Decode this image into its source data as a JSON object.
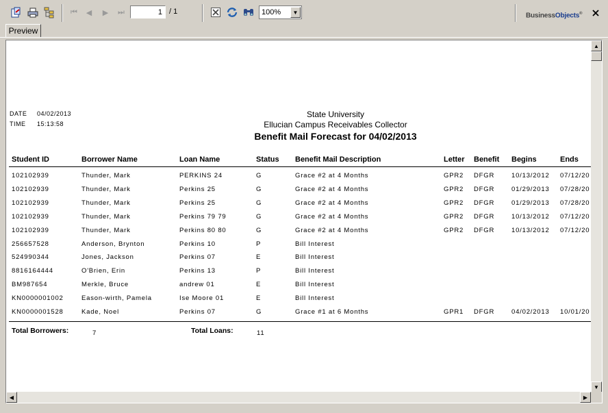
{
  "toolbar": {
    "page_current": "1",
    "page_total": "/ 1",
    "zoom": "100%",
    "logo_a": "Business",
    "logo_b": "Objects",
    "logo_tm": "®"
  },
  "tabs": [
    {
      "label": "Preview"
    }
  ],
  "report": {
    "date_label": "DATE",
    "date_value": "04/02/2013",
    "time_label": "TIME",
    "time_value": "15:13:58",
    "institution": "State University",
    "system": "Ellucian Campus Receivables Collector",
    "title": "Benefit Mail Forecast for 04/02/2013",
    "columns": [
      "Student ID",
      "Borrower Name",
      "Loan Name",
      "Status",
      "Benefit Mail Description",
      "Letter",
      "Benefit",
      "Begins",
      "Ends"
    ],
    "rows": [
      [
        "102102939",
        "Thunder, Mark",
        "PERKINS 24",
        "G",
        "Grace #2 at 4 Months",
        "GPR2",
        "DFGR",
        "10/13/2012",
        "07/12/20"
      ],
      [
        "102102939",
        "Thunder, Mark",
        "Perkins 25",
        "G",
        "Grace #2 at 4 Months",
        "GPR2",
        "DFGR",
        "01/29/2013",
        "07/28/20"
      ],
      [
        "102102939",
        "Thunder, Mark",
        "Perkins 25",
        "G",
        "Grace #2 at 4 Months",
        "GPR2",
        "DFGR",
        "01/29/2013",
        "07/28/20"
      ],
      [
        "102102939",
        "Thunder, Mark",
        "Perkins 79 79",
        "G",
        "Grace #2 at 4 Months",
        "GPR2",
        "DFGR",
        "10/13/2012",
        "07/12/20"
      ],
      [
        "102102939",
        "Thunder, Mark",
        "Perkins 80 80",
        "G",
        "Grace #2 at 4 Months",
        "GPR2",
        "DFGR",
        "10/13/2012",
        "07/12/20"
      ],
      [
        "256657528",
        "Anderson, Brynton",
        "Perkins 10",
        "P",
        "Bill Interest",
        "",
        "",
        "",
        ""
      ],
      [
        "524990344",
        "Jones, Jackson",
        "Perkins 07",
        "E",
        "Bill Interest",
        "",
        "",
        "",
        ""
      ],
      [
        "8816164444",
        "O'Brien, Erin",
        "Perkins 13",
        "P",
        "Bill Interest",
        "",
        "",
        "",
        ""
      ],
      [
        "BM987654",
        "Merkle, Bruce",
        "andrew 01",
        "E",
        "Bill Interest",
        "",
        "",
        "",
        ""
      ],
      [
        "KN0000001002",
        "Eason-wirth, Pamela",
        "Ise Moore 01",
        "E",
        "Bill Interest",
        "",
        "",
        "",
        ""
      ],
      [
        "KN0000001528",
        "Kade, Noel",
        "Perkins 07",
        "G",
        "Grace #1 at 6 Months",
        "GPR1",
        "DFGR",
        "04/02/2013",
        "10/01/20"
      ]
    ],
    "total_borrowers_label": "Total Borrowers:",
    "total_borrowers": "7",
    "total_loans_label": "Total Loans:",
    "total_loans": "11"
  }
}
